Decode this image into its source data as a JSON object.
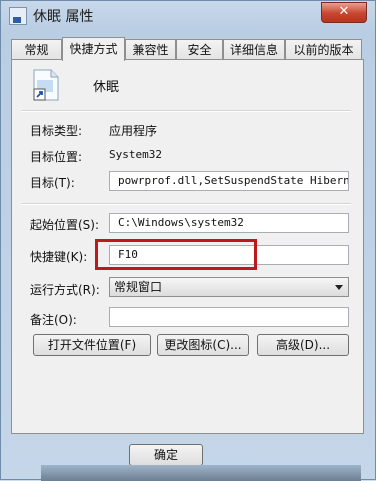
{
  "window": {
    "title": "休眠 属性",
    "close_symbol": "✕"
  },
  "tabs": [
    {
      "label": "常规"
    },
    {
      "label": "快捷方式"
    },
    {
      "label": "兼容性"
    },
    {
      "label": "安全"
    },
    {
      "label": "详细信息"
    },
    {
      "label": "以前的版本"
    }
  ],
  "shortcut": {
    "name": "休眠",
    "target_type_label": "目标类型:",
    "target_type_value": "应用程序",
    "target_location_label": "目标位置:",
    "target_location_value": "System32",
    "target_label": "目标(T):",
    "target_value": "powrprof.dll,SetSuspendState Hibernate",
    "start_in_label": "起始位置(S):",
    "start_in_value": "C:\\Windows\\system32",
    "hotkey_label": "快捷键(K):",
    "hotkey_value": "F10",
    "run_label": "运行方式(R):",
    "run_value": "常规窗口",
    "comment_label": "备注(O):",
    "comment_value": ""
  },
  "buttons": {
    "open_location": "打开文件位置(F)",
    "change_icon": "更改图标(C)...",
    "advanced": "高级(D)...",
    "ok": "确定"
  },
  "colors": {
    "highlight": "#c0171d"
  }
}
